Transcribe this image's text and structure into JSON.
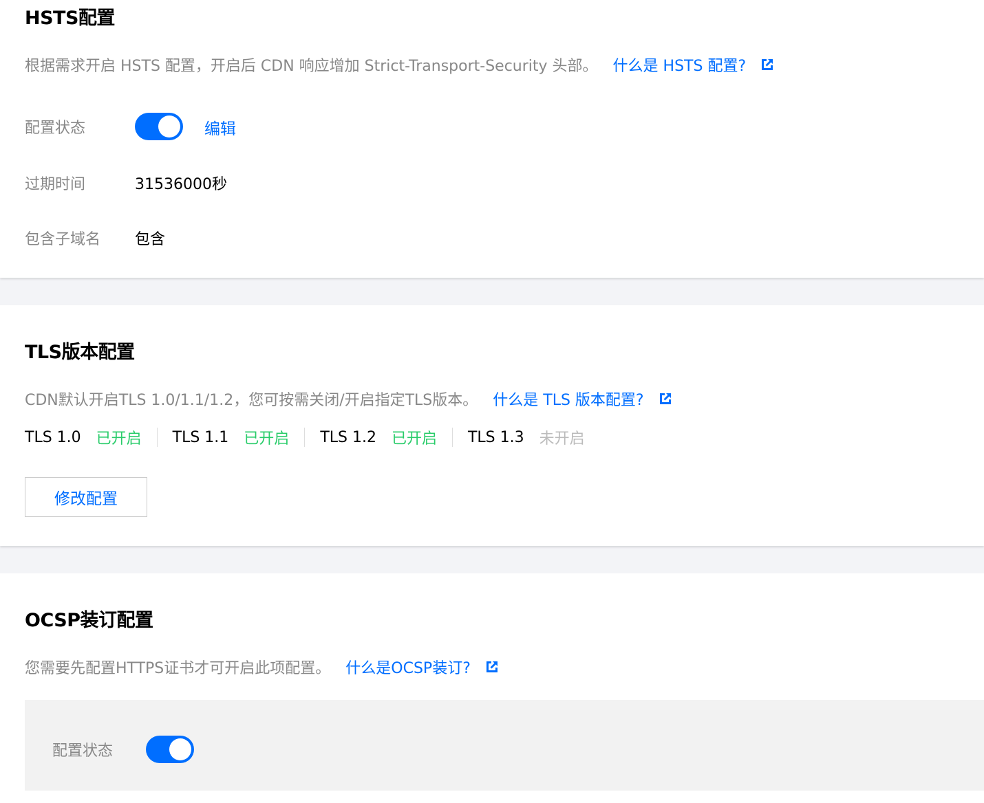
{
  "hsts": {
    "title": "HSTS配置",
    "description": "根据需求开启 HSTS 配置，开启后 CDN 响应增加 Strict-Transport-Security 头部。",
    "help_link": "什么是 HSTS 配置?",
    "status_label": "配置状态",
    "status_enabled": true,
    "edit_label": "编辑",
    "expire_label": "过期时间",
    "expire_value": "31536000秒",
    "subdomain_label": "包含子域名",
    "subdomain_value": "包含"
  },
  "tls": {
    "title": "TLS版本配置",
    "description": "CDN默认开启TLS 1.0/1.1/1.2，您可按需关闭/开启指定TLS版本。",
    "help_link": "什么是 TLS 版本配置?",
    "versions": [
      {
        "name": "TLS 1.0",
        "status": "已开启",
        "enabled": true
      },
      {
        "name": "TLS 1.1",
        "status": "已开启",
        "enabled": true
      },
      {
        "name": "TLS 1.2",
        "status": "已开启",
        "enabled": true
      },
      {
        "name": "TLS 1.3",
        "status": "未开启",
        "enabled": false
      }
    ],
    "modify_button": "修改配置"
  },
  "ocsp": {
    "title": "OCSP装订配置",
    "description": "您需要先配置HTTPS证书才可开启此项配置。",
    "help_link": "什么是OCSP装订?",
    "status_label": "配置状态",
    "status_enabled": true
  },
  "colors": {
    "accent": "#006eff",
    "enabled_text": "#29cc6a",
    "disabled_text": "#bbbbbb"
  },
  "icons": {
    "external_link": "external-link-icon"
  }
}
